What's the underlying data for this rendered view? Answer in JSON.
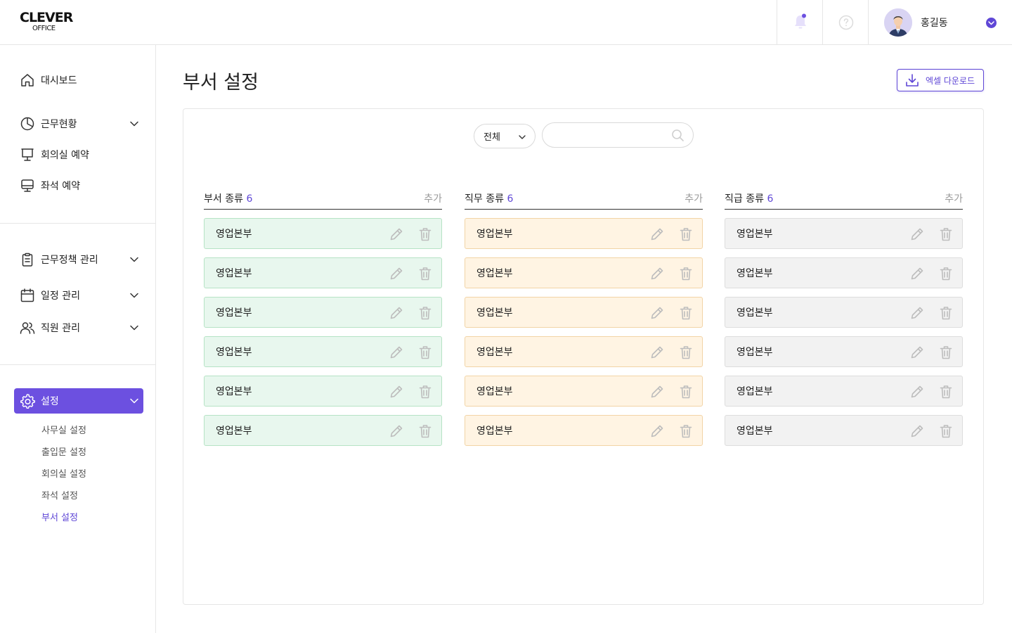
{
  "app": {
    "logo_top": "CLEVER",
    "logo_bottom": "OFFICE"
  },
  "header": {
    "user_name": "홍길동",
    "icons": [
      "bell-icon",
      "help-icon",
      "chevron-down-icon"
    ],
    "accent": "#5f47d6"
  },
  "sidebar": {
    "dashboard": "대시보드",
    "work_status": "근무현황",
    "meeting_room": "회의실 예약",
    "seat": "좌석 예약",
    "policy": "근무정책 관리",
    "schedule": "일정 관리",
    "staff": "직원 관리",
    "settings": "설정",
    "settings_sub": [
      "사무실 설정",
      "출입문 설정",
      "회의실 설정",
      "좌석 설정",
      "부서 설정"
    ]
  },
  "main": {
    "title": "부서 설정",
    "excel_label": "엑셀 다운로드",
    "filter": {
      "value": "전체"
    },
    "search": {
      "value": "",
      "placeholder": ""
    },
    "columns": [
      {
        "title": "부서 종류",
        "count": "6",
        "add_label": "추가",
        "color": "#e8f7ee",
        "items": [
          "영업본부",
          "영업본부",
          "영업본부",
          "영업본부",
          "영업본부",
          "영업본부"
        ]
      },
      {
        "title": "직무 종류",
        "count": "6",
        "add_label": "추가",
        "color": "#fff4e3",
        "items": [
          "영업본부",
          "영업본부",
          "영업본부",
          "영업본부",
          "영업본부",
          "영업본부"
        ]
      },
      {
        "title": "직급 종류",
        "count": "6",
        "add_label": "추가",
        "color": "#f2f2f2",
        "items": [
          "영업본부",
          "영업본부",
          "영업본부",
          "영업본부",
          "영업본부",
          "영업본부"
        ]
      }
    ]
  }
}
